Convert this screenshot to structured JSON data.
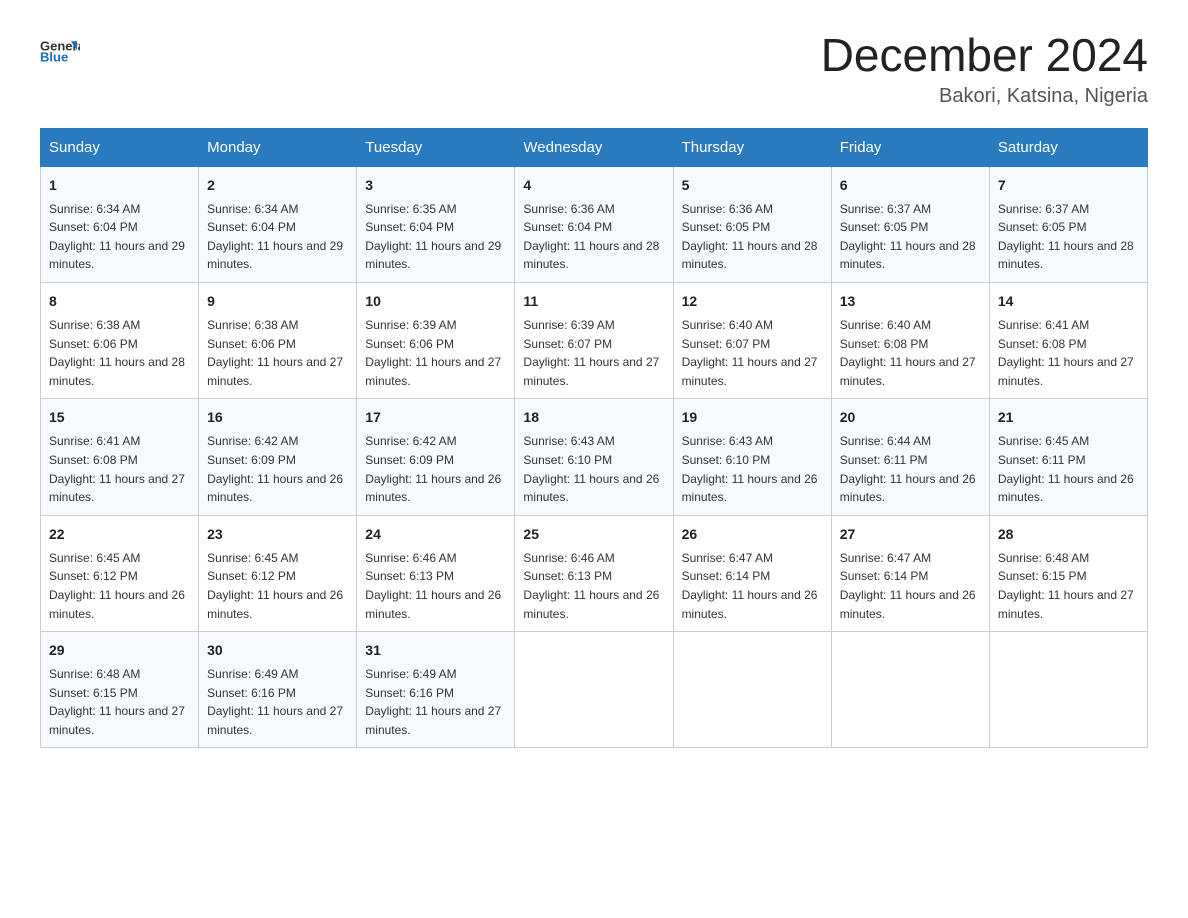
{
  "header": {
    "logo": {
      "text_general": "General",
      "text_blue": "Blue"
    },
    "title": "December 2024",
    "location": "Bakori, Katsina, Nigeria"
  },
  "calendar": {
    "days_of_week": [
      "Sunday",
      "Monday",
      "Tuesday",
      "Wednesday",
      "Thursday",
      "Friday",
      "Saturday"
    ],
    "weeks": [
      [
        {
          "day": "1",
          "sunrise": "6:34 AM",
          "sunset": "6:04 PM",
          "daylight": "11 hours and 29 minutes."
        },
        {
          "day": "2",
          "sunrise": "6:34 AM",
          "sunset": "6:04 PM",
          "daylight": "11 hours and 29 minutes."
        },
        {
          "day": "3",
          "sunrise": "6:35 AM",
          "sunset": "6:04 PM",
          "daylight": "11 hours and 29 minutes."
        },
        {
          "day": "4",
          "sunrise": "6:36 AM",
          "sunset": "6:04 PM",
          "daylight": "11 hours and 28 minutes."
        },
        {
          "day": "5",
          "sunrise": "6:36 AM",
          "sunset": "6:05 PM",
          "daylight": "11 hours and 28 minutes."
        },
        {
          "day": "6",
          "sunrise": "6:37 AM",
          "sunset": "6:05 PM",
          "daylight": "11 hours and 28 minutes."
        },
        {
          "day": "7",
          "sunrise": "6:37 AM",
          "sunset": "6:05 PM",
          "daylight": "11 hours and 28 minutes."
        }
      ],
      [
        {
          "day": "8",
          "sunrise": "6:38 AM",
          "sunset": "6:06 PM",
          "daylight": "11 hours and 28 minutes."
        },
        {
          "day": "9",
          "sunrise": "6:38 AM",
          "sunset": "6:06 PM",
          "daylight": "11 hours and 27 minutes."
        },
        {
          "day": "10",
          "sunrise": "6:39 AM",
          "sunset": "6:06 PM",
          "daylight": "11 hours and 27 minutes."
        },
        {
          "day": "11",
          "sunrise": "6:39 AM",
          "sunset": "6:07 PM",
          "daylight": "11 hours and 27 minutes."
        },
        {
          "day": "12",
          "sunrise": "6:40 AM",
          "sunset": "6:07 PM",
          "daylight": "11 hours and 27 minutes."
        },
        {
          "day": "13",
          "sunrise": "6:40 AM",
          "sunset": "6:08 PM",
          "daylight": "11 hours and 27 minutes."
        },
        {
          "day": "14",
          "sunrise": "6:41 AM",
          "sunset": "6:08 PM",
          "daylight": "11 hours and 27 minutes."
        }
      ],
      [
        {
          "day": "15",
          "sunrise": "6:41 AM",
          "sunset": "6:08 PM",
          "daylight": "11 hours and 27 minutes."
        },
        {
          "day": "16",
          "sunrise": "6:42 AM",
          "sunset": "6:09 PM",
          "daylight": "11 hours and 26 minutes."
        },
        {
          "day": "17",
          "sunrise": "6:42 AM",
          "sunset": "6:09 PM",
          "daylight": "11 hours and 26 minutes."
        },
        {
          "day": "18",
          "sunrise": "6:43 AM",
          "sunset": "6:10 PM",
          "daylight": "11 hours and 26 minutes."
        },
        {
          "day": "19",
          "sunrise": "6:43 AM",
          "sunset": "6:10 PM",
          "daylight": "11 hours and 26 minutes."
        },
        {
          "day": "20",
          "sunrise": "6:44 AM",
          "sunset": "6:11 PM",
          "daylight": "11 hours and 26 minutes."
        },
        {
          "day": "21",
          "sunrise": "6:45 AM",
          "sunset": "6:11 PM",
          "daylight": "11 hours and 26 minutes."
        }
      ],
      [
        {
          "day": "22",
          "sunrise": "6:45 AM",
          "sunset": "6:12 PM",
          "daylight": "11 hours and 26 minutes."
        },
        {
          "day": "23",
          "sunrise": "6:45 AM",
          "sunset": "6:12 PM",
          "daylight": "11 hours and 26 minutes."
        },
        {
          "day": "24",
          "sunrise": "6:46 AM",
          "sunset": "6:13 PM",
          "daylight": "11 hours and 26 minutes."
        },
        {
          "day": "25",
          "sunrise": "6:46 AM",
          "sunset": "6:13 PM",
          "daylight": "11 hours and 26 minutes."
        },
        {
          "day": "26",
          "sunrise": "6:47 AM",
          "sunset": "6:14 PM",
          "daylight": "11 hours and 26 minutes."
        },
        {
          "day": "27",
          "sunrise": "6:47 AM",
          "sunset": "6:14 PM",
          "daylight": "11 hours and 26 minutes."
        },
        {
          "day": "28",
          "sunrise": "6:48 AM",
          "sunset": "6:15 PM",
          "daylight": "11 hours and 27 minutes."
        }
      ],
      [
        {
          "day": "29",
          "sunrise": "6:48 AM",
          "sunset": "6:15 PM",
          "daylight": "11 hours and 27 minutes."
        },
        {
          "day": "30",
          "sunrise": "6:49 AM",
          "sunset": "6:16 PM",
          "daylight": "11 hours and 27 minutes."
        },
        {
          "day": "31",
          "sunrise": "6:49 AM",
          "sunset": "6:16 PM",
          "daylight": "11 hours and 27 minutes."
        },
        null,
        null,
        null,
        null
      ]
    ]
  }
}
